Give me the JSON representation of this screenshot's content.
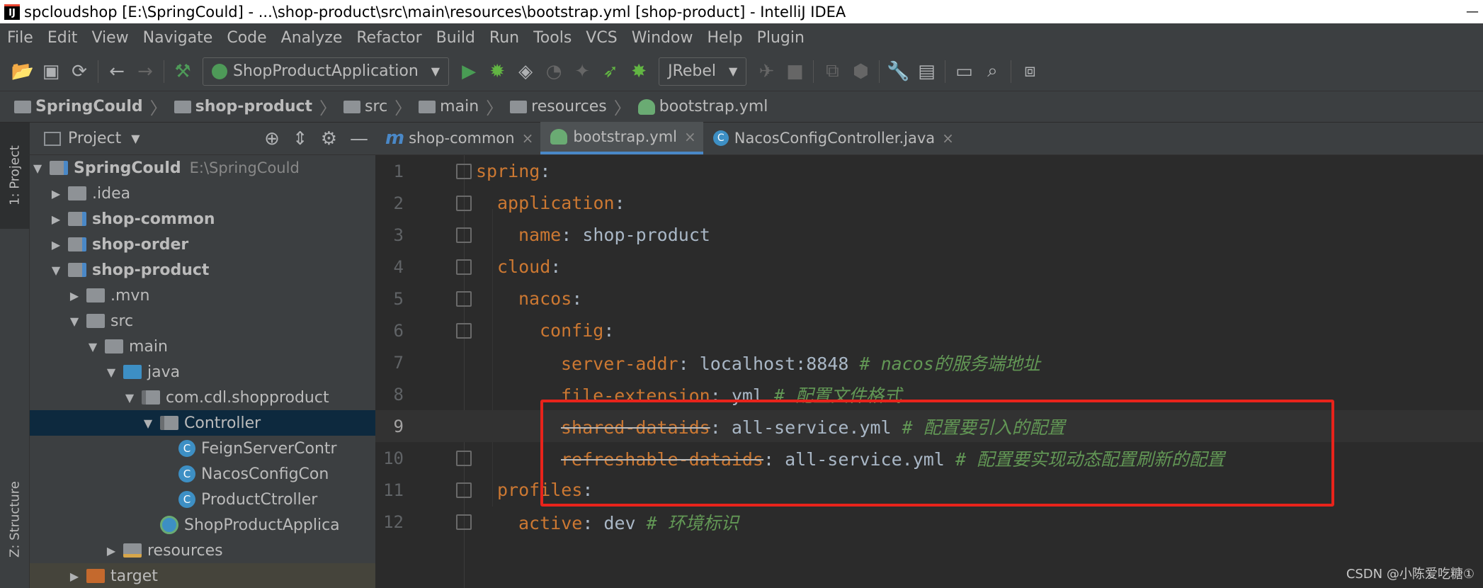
{
  "window": {
    "app_icon": "IJ",
    "title": "spcloudshop [E:\\SpringCould] - ...\\shop-product\\src\\main\\resources\\bootstrap.yml [shop-product] - IntelliJ IDEA",
    "minimize": "—"
  },
  "menu": {
    "items": [
      "File",
      "Edit",
      "View",
      "Navigate",
      "Code",
      "Analyze",
      "Refactor",
      "Build",
      "Run",
      "Tools",
      "VCS",
      "Window",
      "Help",
      "Plugin"
    ]
  },
  "toolbar": {
    "run_config": "ShopProductApplication",
    "jrebel": "JRebel"
  },
  "breadcrumb": {
    "items": [
      "SpringCould",
      "shop-product",
      "src",
      "main",
      "resources",
      "bootstrap.yml"
    ]
  },
  "side_tabs": {
    "project": "1: Project",
    "structure": "Z: Structure"
  },
  "project_panel": {
    "title": "Project",
    "tree": {
      "root_name": "SpringCould",
      "root_path": "E:\\SpringCould",
      "idea": ".idea",
      "shop_common": "shop-common",
      "shop_order": "shop-order",
      "shop_product": "shop-product",
      "mvn": ".mvn",
      "src": "src",
      "main": "main",
      "java": "java",
      "package": "com.cdl.shopproduct",
      "controller": "Controller",
      "feign": "FeignServerContr",
      "nacos": "NacosConfigCon",
      "product": "ProductCtroller",
      "app": "ShopProductApplica",
      "resources": "resources",
      "target": "target"
    }
  },
  "tabs": {
    "t1": "shop-common",
    "t2": "bootstrap.yml",
    "t3": "NacosConfigController.java"
  },
  "code": {
    "l1_key": "spring",
    "l2_key": "application",
    "l3_key": "name",
    "l3_val": "shop-product",
    "l4_key": "cloud",
    "l5_key": "nacos",
    "l6_key": "config",
    "l7_key": "server-addr",
    "l7_val": "localhost:8848",
    "l7_cmt": "# nacos的服务端地址",
    "l8_key": "file-extension",
    "l8_val": "yml",
    "l8_cmt": "# 配置文件格式",
    "l9_key": "shared-dataids",
    "l9_val": "all-service.yml",
    "l9_cmt": "# 配置要引入的配置",
    "l10_key": "refreshable-dataids",
    "l10_val": "all-service.yml",
    "l10_cmt": "# 配置要实现动态配置刷新的配置",
    "l11_key": "profiles",
    "l12_key": "active",
    "l12_val": "dev",
    "l12_cmt": "# 环境标识"
  },
  "watermark": "CSDN @小陈爱吃糖①",
  "colors": {
    "highlight_box": "#e8231b",
    "yaml_key": "#cc7832",
    "comment": "#629755"
  }
}
